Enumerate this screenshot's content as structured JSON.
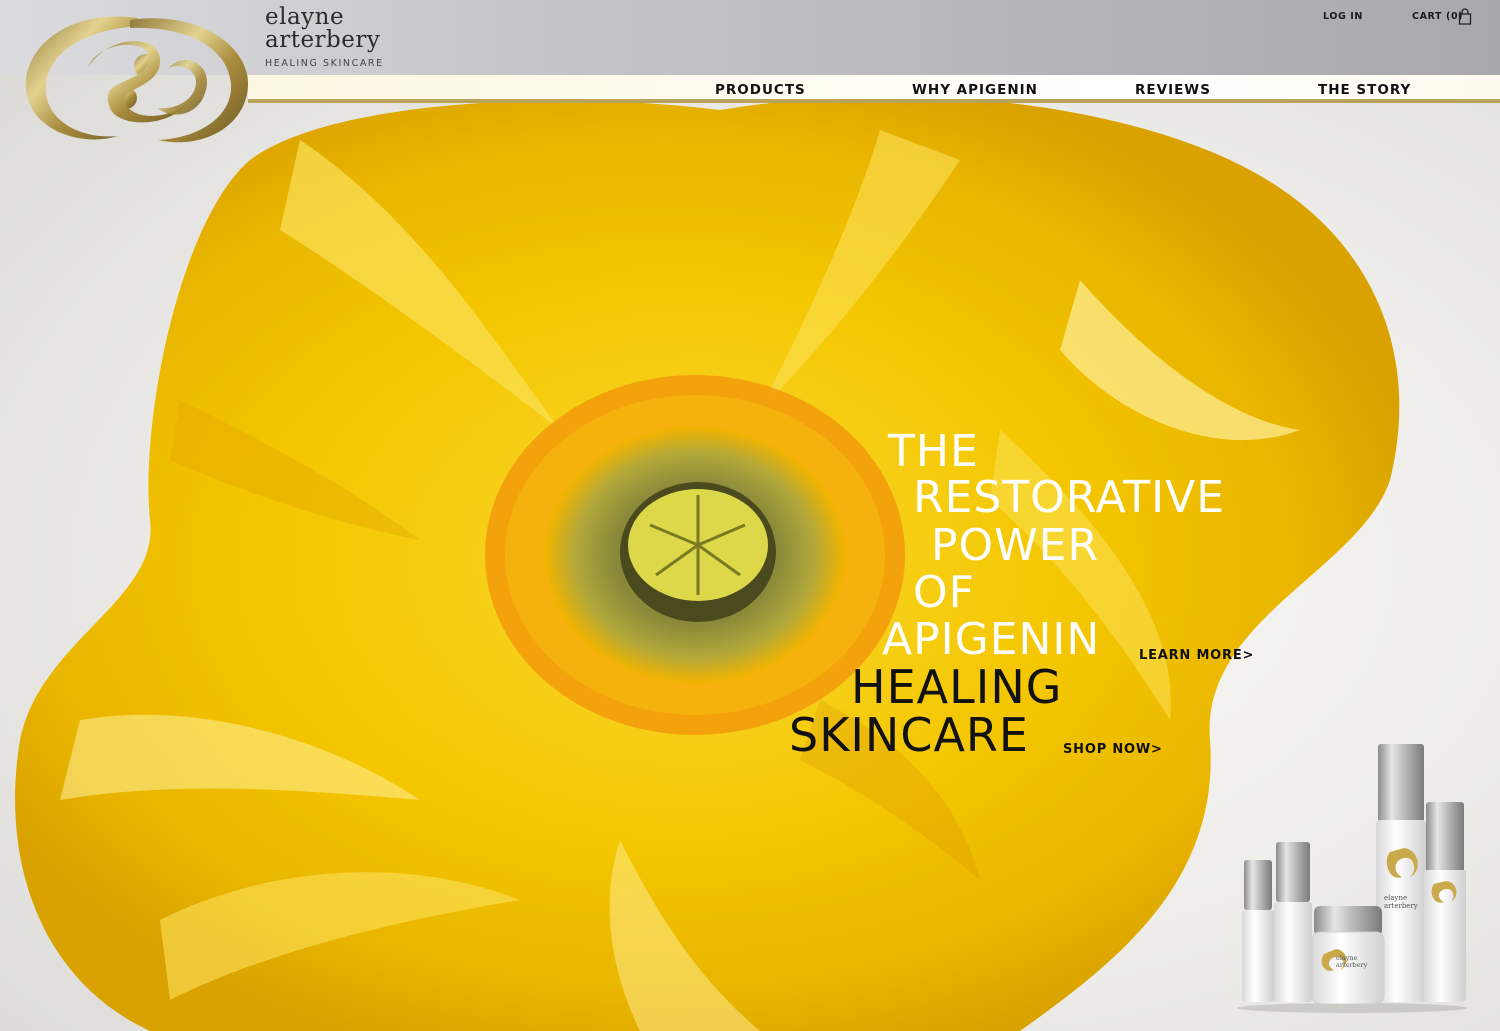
{
  "brand": {
    "name_line1": "elayne",
    "name_line2": "arterbery",
    "tagline": "HEALING SKINCARE",
    "accent_gold": "#b9a35a"
  },
  "utility": {
    "login": "LOG IN",
    "cart": "CART (0)"
  },
  "nav": {
    "products": "PRODUCTS",
    "why": "WHY APIGENIN",
    "reviews": "REVIEWS",
    "story": "THE STORY"
  },
  "hero": {
    "line1": "THE",
    "line2": "RESTORATIVE",
    "line3": "POWER",
    "line4": "OF",
    "line5": "APIGENIN",
    "learn_more": "LEARN MORE>",
    "line6": "HEALING",
    "line7": "SKINCARE",
    "shop_now": "SHOP NOW>",
    "flower_color": "#f5cd06"
  },
  "product_labels": {
    "brand_line1": "elayne",
    "brand_line2": "arterbery"
  }
}
